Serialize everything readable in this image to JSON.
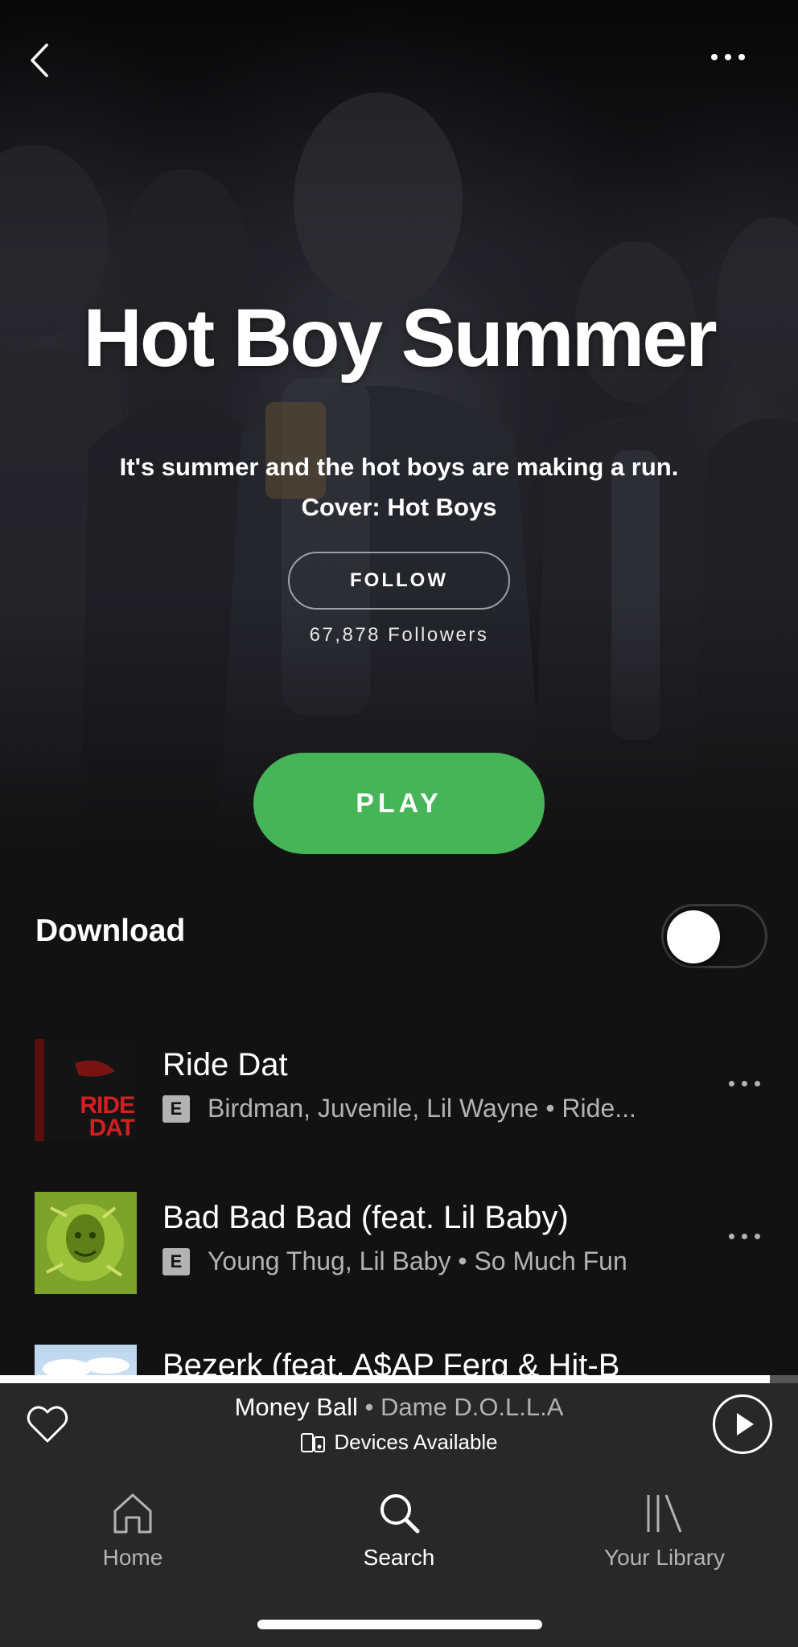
{
  "playlist": {
    "title": "Hot Boy Summer",
    "description_line1": "It's summer and the hot boys are making a run.",
    "description_line2": "Cover: Hot Boys",
    "follow_label": "FOLLOW",
    "followers": "67,878 Followers",
    "play_label": "PLAY"
  },
  "download": {
    "label": "Download",
    "enabled": false
  },
  "tracks": [
    {
      "title": "Ride Dat",
      "explicit": "E",
      "subtitle": "Birdman, Juvenile, Lil Wayne • Ride...",
      "art_text": "RIDE DAT"
    },
    {
      "title": "Bad Bad Bad (feat. Lil Baby)",
      "explicit": "E",
      "subtitle": "Young Thug, Lil Baby • So Much Fun"
    },
    {
      "title": "Bezerk (feat. A$AP Ferg & Hit-B"
    }
  ],
  "now_playing": {
    "track": "Money Ball",
    "separator": " • ",
    "artist": "Dame D.O.L.L.A",
    "devices": "Devices Available",
    "progress": 0.965
  },
  "tabs": [
    {
      "label": "Home",
      "icon": "home-icon"
    },
    {
      "label": "Search",
      "icon": "search-icon"
    },
    {
      "label": "Your Library",
      "icon": "library-icon"
    }
  ],
  "colors": {
    "accent": "#45b557",
    "background": "#121212",
    "bar": "#282828",
    "secondary_text": "#b3b3b3"
  }
}
